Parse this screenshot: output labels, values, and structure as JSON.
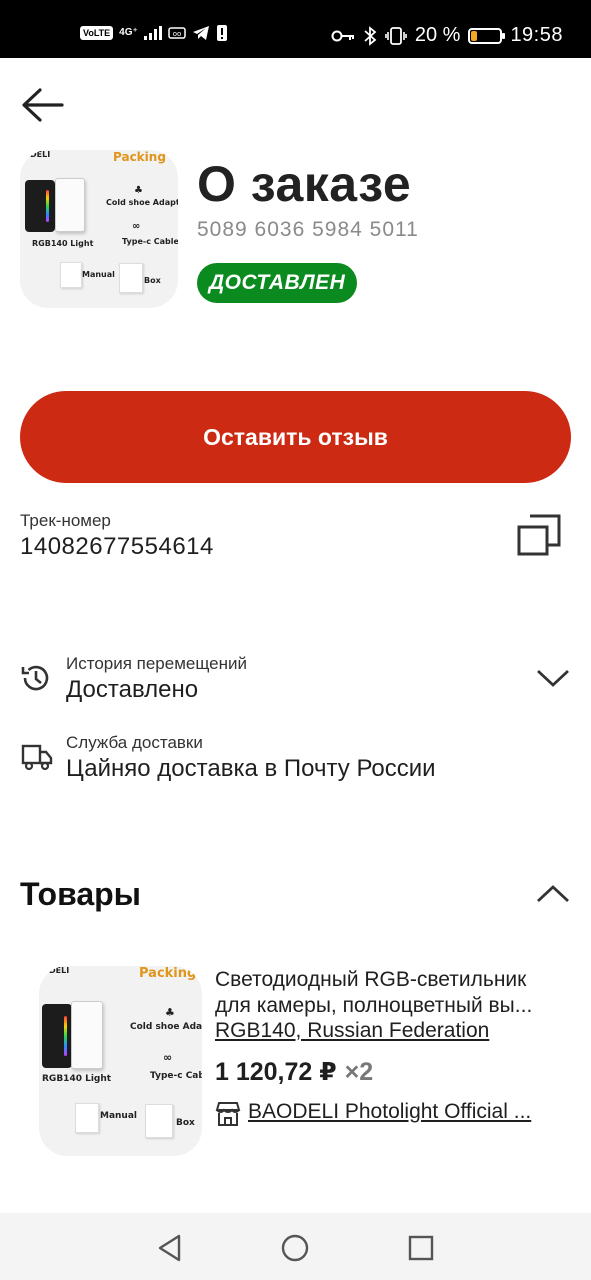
{
  "status_bar": {
    "volte": "VoLTE",
    "network": "4G⁺",
    "battery_text": "20 %",
    "battery_level": 0.2,
    "time": "19:58"
  },
  "header": {
    "title": "О заказе",
    "order_number": "5089 6036 5984 5011",
    "status_badge": "ДОСТАВЛЕН",
    "status_color": "#0a8a1f"
  },
  "image": {
    "brand": "DELI",
    "packing": "Packing",
    "cold_shoe": "Cold shoe Adapter",
    "cold_shoe_short": "Cold shoe Adap",
    "type_c": "Type-c Cable",
    "type_c_short": "Type-c Cabl",
    "rgb": "RGB140  Light",
    "manual": "Manual",
    "box": "Box"
  },
  "actions": {
    "review_button": "Оставить отзыв",
    "accent_color": "#cc2a12"
  },
  "tracking": {
    "label": "Трек-номер",
    "value": "14082677554614"
  },
  "movement": {
    "label": "История перемещений",
    "value": "Доставлено"
  },
  "delivery": {
    "label": "Служба доставки",
    "value": "Цайняо доставка в Почту России"
  },
  "products_section": {
    "title": "Товары"
  },
  "product": {
    "title_line1": "Светодиодный RGB-светильник",
    "title_line2": "для камеры, полноцветный вы...",
    "variant": "RGB140, Russian Federation",
    "price": "1 120,72 ₽",
    "quantity": "×2",
    "store": "BAODELI Photolight Official ..."
  },
  "icons": [
    "back-arrow-icon",
    "copy-icon",
    "history-icon",
    "truck-icon",
    "chevron-down-icon",
    "chevron-up-icon",
    "store-icon",
    "nav-back-icon",
    "nav-home-icon",
    "nav-recents-icon"
  ]
}
